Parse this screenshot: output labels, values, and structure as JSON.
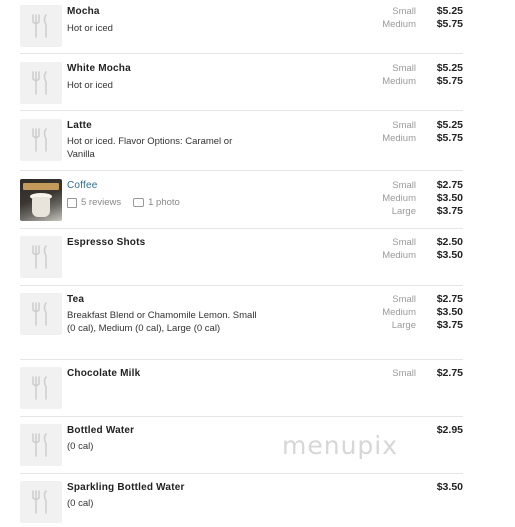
{
  "items": [
    {
      "name": "Mocha",
      "desc": "Hot or iced",
      "sizes": [
        "Small",
        "Medium"
      ],
      "prices": [
        "$5.25",
        "$5.75"
      ]
    },
    {
      "name": "White Mocha",
      "desc": "Hot or iced",
      "sizes": [
        "Small",
        "Medium"
      ],
      "prices": [
        "$5.25",
        "$5.75"
      ]
    },
    {
      "name": "Latte",
      "desc": "Hot or iced. Flavor Options: Caramel or Vanilla",
      "sizes": [
        "Small",
        "Medium"
      ],
      "prices": [
        "$5.25",
        "$5.75"
      ]
    },
    {
      "name": "Coffee",
      "reviews": "5 reviews",
      "photos": "1 photo",
      "sizes": [
        "Small",
        "Medium",
        "Large"
      ],
      "prices": [
        "$2.75",
        "$3.50",
        "$3.75"
      ]
    },
    {
      "name": "Espresso Shots",
      "desc": "",
      "sizes": [
        "Small",
        "Medium"
      ],
      "prices": [
        "$2.50",
        "$3.50"
      ]
    },
    {
      "name": "Tea",
      "desc": "Breakfast Blend or Chamomile Lemon. Small (0 cal), Medium (0 cal), Large (0 cal)",
      "sizes": [
        "Small",
        "Medium",
        "Large"
      ],
      "prices": [
        "$2.75",
        "$3.50",
        "$3.75"
      ]
    },
    {
      "name": "Chocolate Milk",
      "desc": "",
      "sizes": [
        "Small"
      ],
      "prices": [
        "$2.75"
      ]
    },
    {
      "name": "Bottled Water",
      "desc": "(0 cal)",
      "sizes": [],
      "prices": [
        "$2.95"
      ]
    },
    {
      "name": "Sparkling Bottled Water",
      "desc": "(0 cal)",
      "sizes": [],
      "prices": [
        "$3.50"
      ]
    }
  ],
  "watermark": "menupix"
}
